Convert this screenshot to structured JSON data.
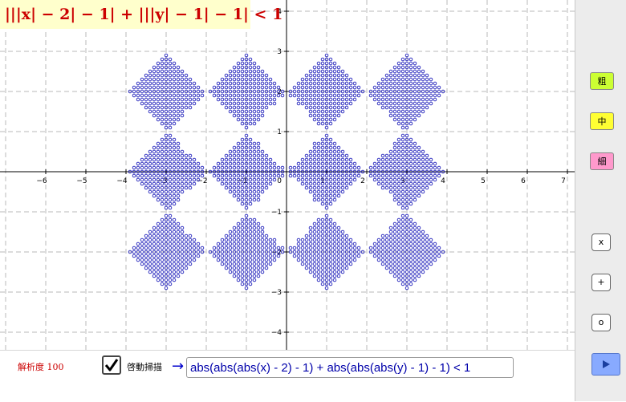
{
  "formula": "|||x| − 2| − 1| + |||y| − 1| − 1| < 1",
  "axes": {
    "x_ticks": [
      "−6",
      "−5",
      "−4",
      "−3",
      "−2",
      "−1",
      "1",
      "2",
      "3",
      "4",
      "5",
      "6",
      "7"
    ],
    "y_ticks": [
      "4",
      "3",
      "2",
      "1",
      "−1",
      "−2",
      "−3",
      "−4"
    ],
    "origin_label": "0"
  },
  "colors": {
    "dots": "#2222bb",
    "formula_text": "#cc0000",
    "formula_bg": "#ffffcc",
    "grid": "#b8b8b8"
  },
  "side_buttons": {
    "coarse": "粗",
    "medium": "中",
    "fine": "細",
    "x": "x",
    "plus": "+",
    "o": "o"
  },
  "bottom": {
    "resolution_label": "解析度 100",
    "checkbox_checked": true,
    "sweep_label": "啓動掃描",
    "arrow": "→",
    "expression": "abs(abs(abs(x) - 2) - 1) + abs(abs(abs(y) - 1) - 1) < 1"
  },
  "icons": {
    "play": "play-icon",
    "check": "check-icon"
  }
}
